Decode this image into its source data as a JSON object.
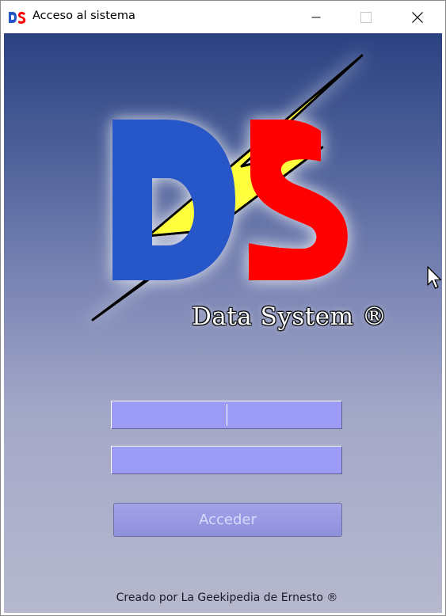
{
  "window": {
    "title": "Acceso al sistema",
    "icon": "ds-logo-icon",
    "controls": [
      "minimize-icon",
      "maximize-icon",
      "close-icon"
    ]
  },
  "logo": {
    "letters": "DS",
    "brand": "Data System ®",
    "colors": {
      "d": "#2556c8",
      "s": "#ff0000",
      "bolt": "#ffff3c"
    }
  },
  "form": {
    "username": {
      "value": "",
      "placeholder": ""
    },
    "password": {
      "value": "",
      "placeholder": ""
    },
    "submit_label": "Acceder"
  },
  "footer": {
    "credit": "Creado por La Geekipedia de Ernesto ®"
  },
  "colors": {
    "background_top": "#2b4282",
    "background_bottom": "#b6b8cd",
    "field": "#9c9cf6",
    "button": "#9a9be4"
  }
}
